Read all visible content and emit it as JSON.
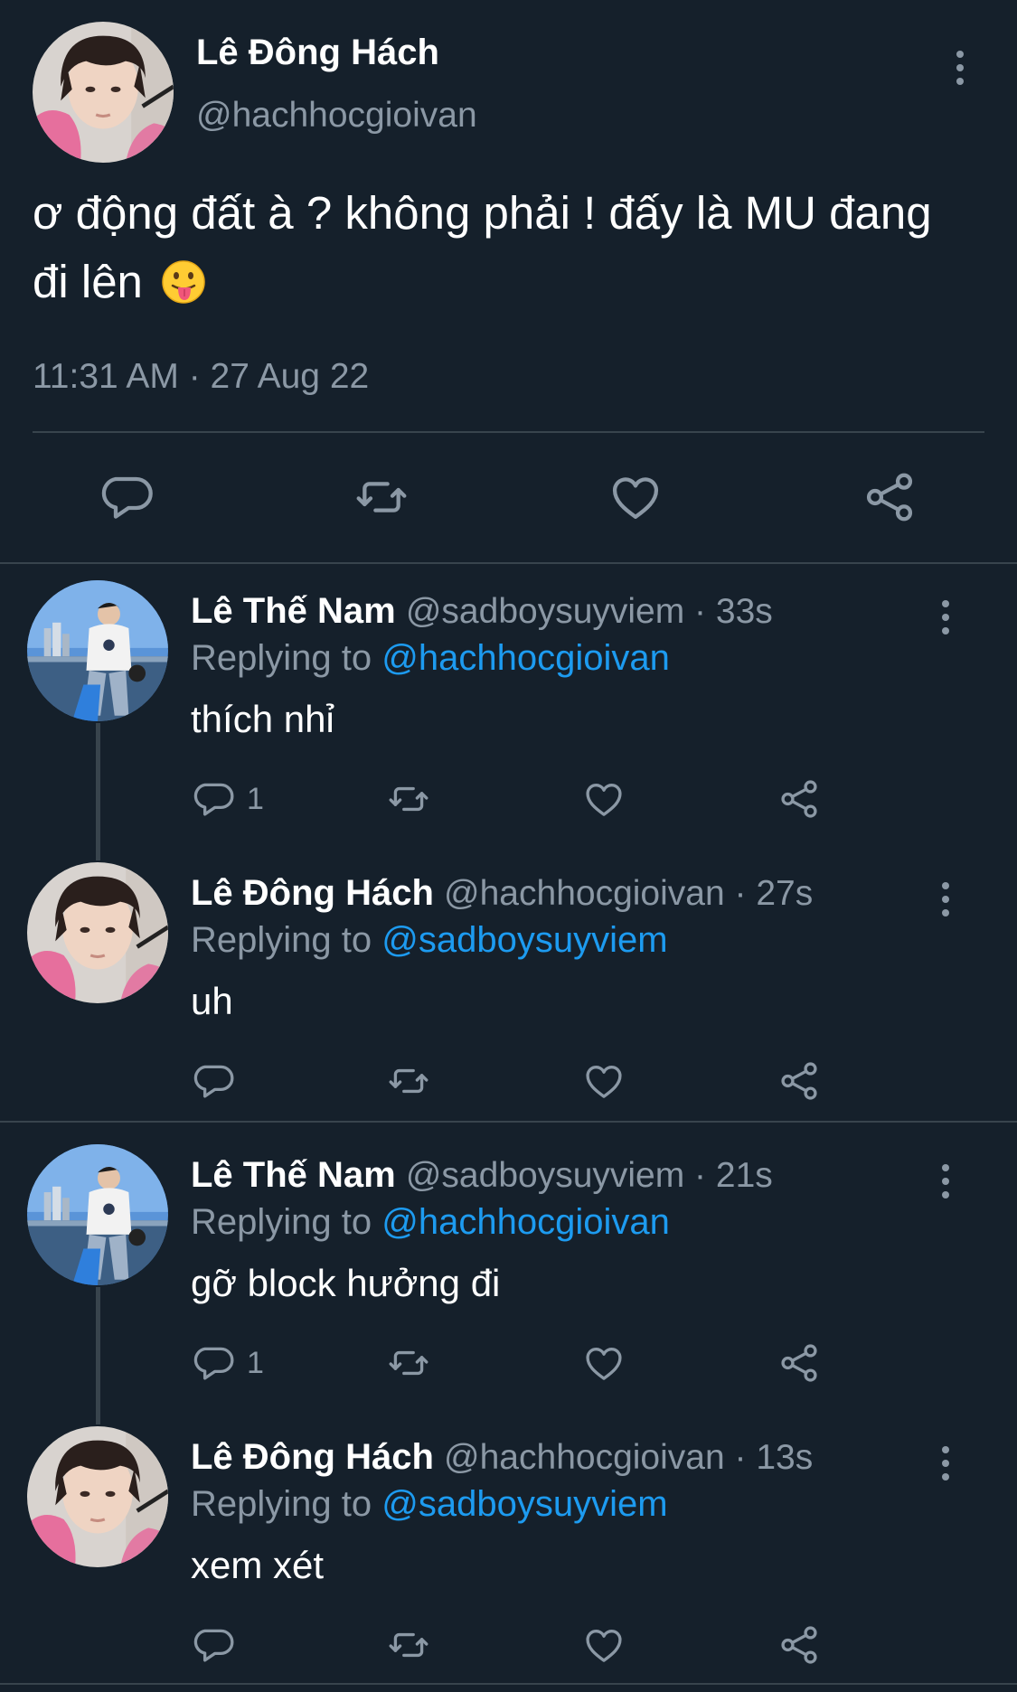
{
  "main_tweet": {
    "author": "Lê Đông Hách",
    "handle": "@hachhocgioivan",
    "text": "ơ động đất à ? không phải ! đấy là MU đang đi lên",
    "emoji": "face-with-tongue-emoji",
    "timestamp": "11:31 AM · 27 Aug 22",
    "actions": [
      "reply-icon",
      "retweet-icon",
      "like-icon",
      "share-icon"
    ]
  },
  "replies": [
    {
      "author": "Lê Thế Nam",
      "meta": "@sadboysuyviem · 33s",
      "replying_prefix": "Replying to ",
      "replying_to": "@hachhocgioivan",
      "text": "thích nhỉ",
      "reply_count": "1"
    },
    {
      "author": "Lê Đông Hách",
      "meta": "@hachhocgioivan · 27s",
      "replying_prefix": "Replying to ",
      "replying_to": "@sadboysuyviem",
      "text": "uh",
      "reply_count": ""
    },
    {
      "author": "Lê Thế Nam",
      "meta": "@sadboysuyviem · 21s",
      "replying_prefix": "Replying to ",
      "replying_to": "@hachhocgioivan",
      "text": "gỡ block hưởng đi",
      "reply_count": "1"
    },
    {
      "author": "Lê Đông Hách",
      "meta": "@hachhocgioivan · 13s",
      "replying_prefix": "Replying to ",
      "replying_to": "@sadboysuyviem",
      "text": "xem xét",
      "reply_count": ""
    }
  ],
  "colors": {
    "background": "#15202b",
    "secondary_text": "#8b98a5",
    "link": "#1d9bf0",
    "divider": "#38444d"
  }
}
